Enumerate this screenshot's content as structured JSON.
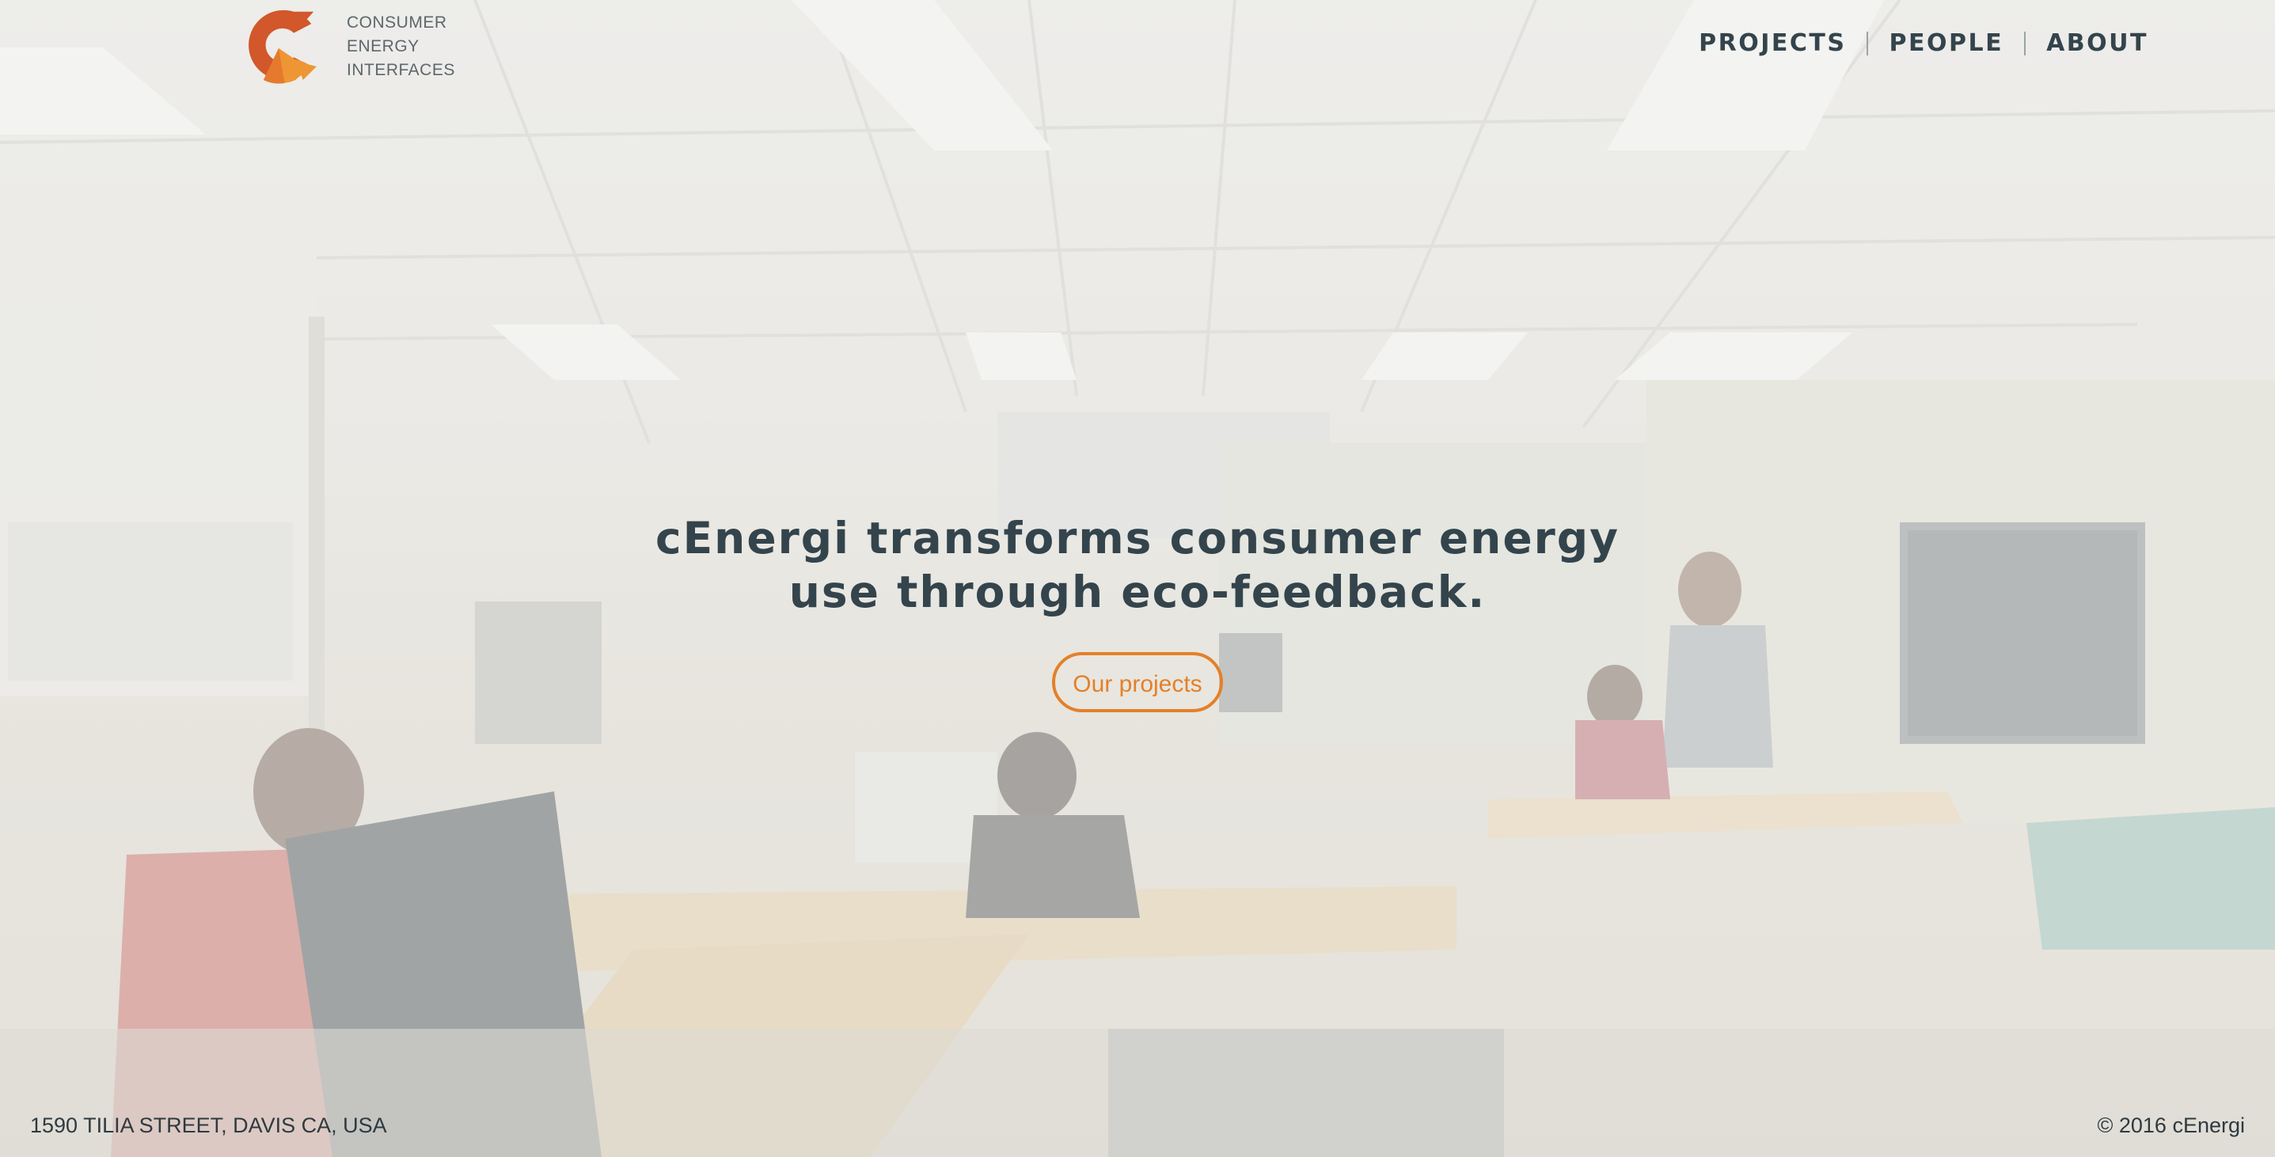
{
  "brand": {
    "logo_lines": [
      "CONSUMER",
      "ENERGY",
      "INTERFACES"
    ],
    "colors": {
      "logo_dark": "#d2572a",
      "logo_light": "#ef9634"
    }
  },
  "nav": {
    "items": [
      {
        "label": "PROJECTS"
      },
      {
        "label": "PEOPLE"
      },
      {
        "label": "ABOUT"
      }
    ]
  },
  "hero": {
    "headline_line1": "cEnergi transforms consumer energy",
    "headline_line2": "use through eco-feedback.",
    "cta_label": "Our projects",
    "accent_color": "#e4802a",
    "text_color": "#34444c"
  },
  "footer": {
    "address": "1590 TILIA STREET, DAVIS CA, USA",
    "copyright": "© 2016 cEnergi"
  }
}
